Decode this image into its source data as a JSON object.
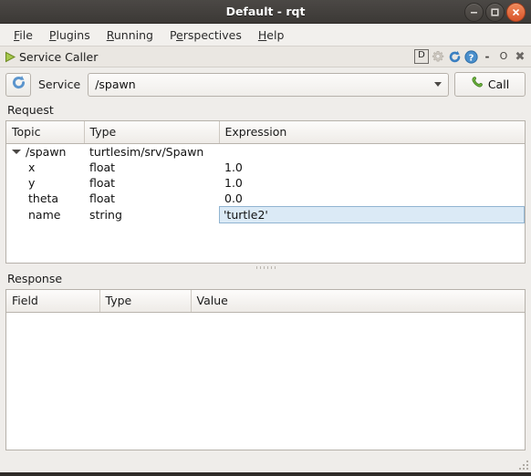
{
  "window": {
    "title": "Default - rqt",
    "buttons": [
      {
        "name": "minimize",
        "glyph": "minimize-icon"
      },
      {
        "name": "maximize",
        "glyph": "maximize-icon"
      },
      {
        "name": "close",
        "glyph": "close-icon"
      }
    ]
  },
  "menubar": {
    "items": [
      {
        "label": "File",
        "mnemonic": "F"
      },
      {
        "label": "Plugins",
        "mnemonic": "P"
      },
      {
        "label": "Running",
        "mnemonic": "R"
      },
      {
        "label": "Perspectives",
        "mnemonic": "e"
      },
      {
        "label": "Help",
        "mnemonic": "H"
      }
    ]
  },
  "dock": {
    "title": "Service Caller",
    "icon": "play-triangle-icon",
    "tools": [
      {
        "name": "dock-d-button",
        "label": "D"
      },
      {
        "name": "settings-gear-icon",
        "label": ""
      },
      {
        "name": "reload-c-icon",
        "label": ""
      },
      {
        "name": "help-question-icon",
        "label": ""
      },
      {
        "name": "minimize-dock-button",
        "label": "-"
      },
      {
        "name": "float-dock-button",
        "label": "O"
      },
      {
        "name": "close-dock-button",
        "label": "✖"
      }
    ]
  },
  "service_row": {
    "refresh_tooltip": "refresh-icon",
    "label": "Service",
    "selected_service": "/spawn",
    "call_label": "Call",
    "call_icon": "phone-handset-icon"
  },
  "request": {
    "section_label": "Request",
    "columns": [
      "Topic",
      "Type",
      "Expression"
    ],
    "rows": [
      {
        "topic": "/spawn",
        "type": "turtlesim/srv/Spawn",
        "expression": "",
        "expandable": true,
        "expanded": true,
        "indent": 0,
        "editing": false
      },
      {
        "topic": "x",
        "type": "float",
        "expression": "1.0",
        "expandable": false,
        "expanded": false,
        "indent": 1,
        "editing": false
      },
      {
        "topic": "y",
        "type": "float",
        "expression": "1.0",
        "expandable": false,
        "expanded": false,
        "indent": 1,
        "editing": false
      },
      {
        "topic": "theta",
        "type": "float",
        "expression": "0.0",
        "expandable": false,
        "expanded": false,
        "indent": 1,
        "editing": false
      },
      {
        "topic": "name",
        "type": "string",
        "expression": "'turtle2'",
        "expandable": false,
        "expanded": false,
        "indent": 1,
        "editing": true
      }
    ]
  },
  "response": {
    "section_label": "Response",
    "columns": [
      "Field",
      "Type",
      "Value"
    ],
    "rows": []
  },
  "colors": {
    "window_bg": "#efedea",
    "titlebar": "#3c3936",
    "titlebar_text": "#ffffff",
    "close_button": "#d8542a",
    "table_bg": "#ffffff",
    "header_border": "#b6b1aa",
    "editor_highlight": "#dbeaf6",
    "editor_border": "#91b4d1",
    "call_icon_green": "#5ca832",
    "dock_icon_blue": "#3a7fc1"
  }
}
